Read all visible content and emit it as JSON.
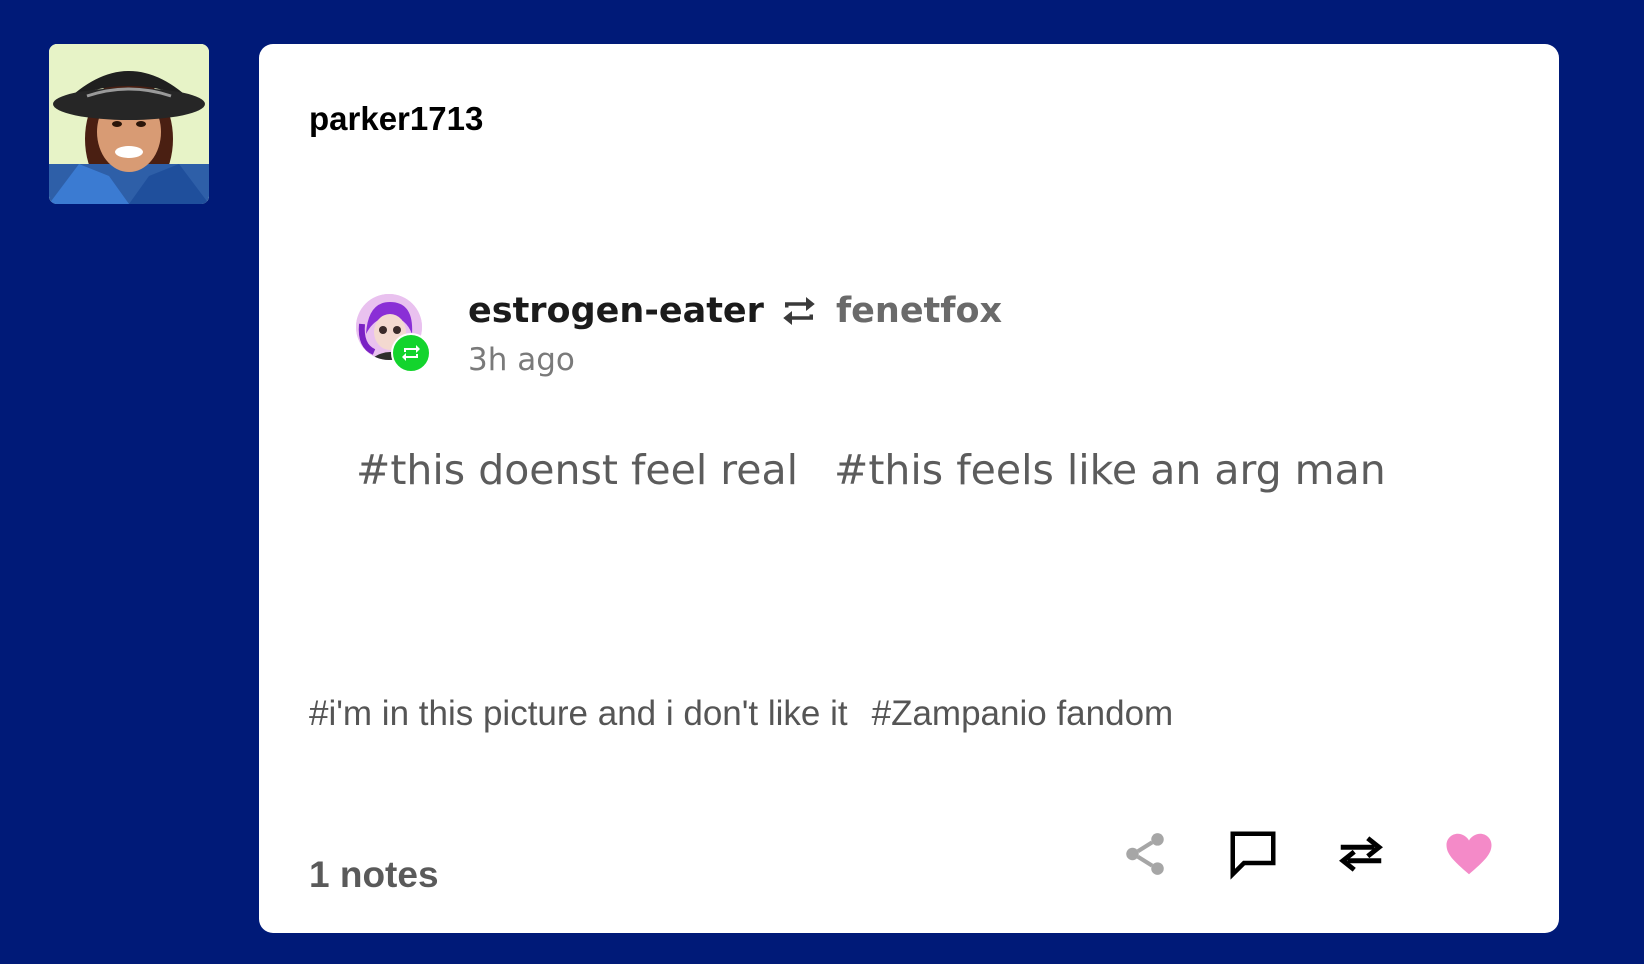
{
  "post": {
    "blog_name": "parker1713",
    "embedded_post": {
      "author": "estrogen-eater",
      "reblogged_from": "fenetfox",
      "timestamp": "3h ago",
      "tags": [
        "#this doenst feel real",
        "#this feels like an arg man"
      ]
    },
    "tags": [
      "#i'm in this picture and i don't like it",
      "#Zampanio fandom"
    ],
    "notes_count": "1 notes"
  },
  "icons": {
    "share": "share-icon",
    "reply": "speech-bubble-icon",
    "reblog": "reblog-arrows-icon",
    "like": "heart-icon"
  },
  "colors": {
    "background": "#001a78",
    "card": "#ffffff",
    "reblog_badge": "#13d42d",
    "like": "#f48ac8"
  }
}
